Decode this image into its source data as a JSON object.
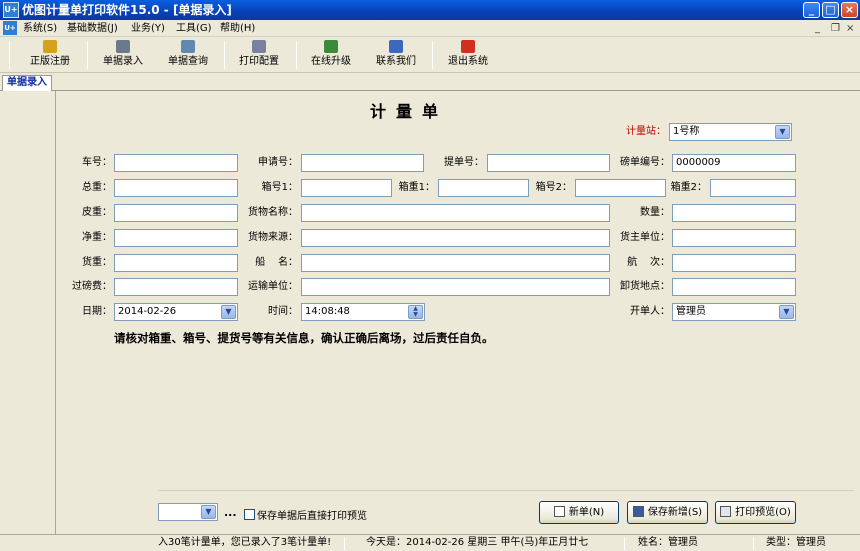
{
  "window": {
    "app_icon": "U+",
    "title": "优图计量单打印软件15.0 - [单据录入]"
  },
  "menu": [
    "系统(S)",
    "基础数据(J)",
    "业务(Y)",
    "工具(G)",
    "帮助(H)"
  ],
  "toolbar": [
    {
      "label": "正版注册",
      "icon": "lock-icon",
      "color": "#d8a020"
    },
    {
      "label": "单据录入",
      "icon": "edit-doc-icon",
      "color": "#6a7a8a"
    },
    {
      "label": "单据查询",
      "icon": "search-doc-icon",
      "color": "#6088b0"
    },
    {
      "label": "打印配置",
      "icon": "printer-config-icon",
      "color": "#7a80a0"
    },
    {
      "label": "在线升级",
      "icon": "upgrade-icon",
      "color": "#3a8a3a"
    },
    {
      "label": "联系我们",
      "icon": "home-icon",
      "color": "#3a6ab8"
    },
    {
      "label": "退出系统",
      "icon": "exit-icon",
      "color": "#d03020"
    }
  ],
  "tab": {
    "label": "单据录入"
  },
  "form": {
    "title": "计量单",
    "station_label": "计量站：",
    "station_value": "1号称",
    "fields": {
      "car_no": {
        "label": "车号：",
        "value": ""
      },
      "apply_no": {
        "label": "申请号：",
        "value": ""
      },
      "bill_no": {
        "label": "提单号：",
        "value": ""
      },
      "weigh_no": {
        "label": "磅单编号：",
        "value": "0000009"
      },
      "gross": {
        "label": "总重：",
        "value": ""
      },
      "box_no1": {
        "label": "箱号1：",
        "value": ""
      },
      "box_wt1": {
        "label": "箱重1：",
        "value": ""
      },
      "box_no2": {
        "label": "箱号2：",
        "value": ""
      },
      "box_wt2": {
        "label": "箱重2：",
        "value": ""
      },
      "tare": {
        "label": "皮重：",
        "value": ""
      },
      "goods_name": {
        "label": "货物名称：",
        "value": ""
      },
      "qty": {
        "label": "数量：",
        "value": ""
      },
      "net": {
        "label": "净重：",
        "value": ""
      },
      "goods_src": {
        "label": "货物来源：",
        "value": ""
      },
      "owner": {
        "label": "货主单位：",
        "value": ""
      },
      "cargo_wt": {
        "label": "货重：",
        "value": ""
      },
      "ship": {
        "label": "船    名：",
        "value": ""
      },
      "voyage": {
        "label": "航    次：",
        "value": ""
      },
      "fee": {
        "label": "过磅费：",
        "value": ""
      },
      "carrier": {
        "label": "运输单位：",
        "value": ""
      },
      "unload": {
        "label": "卸货地点：",
        "value": ""
      },
      "date": {
        "label": "日期：",
        "value": "2014-02-26"
      },
      "time": {
        "label": "时间：",
        "value": "14:08:48"
      },
      "issuer": {
        "label": "开单人：",
        "value": "管理员"
      }
    },
    "notice": "请核对箱重、箱号、提货号等有关信息，确认正确后离场，过后责任自负。"
  },
  "bottom": {
    "dots": "...",
    "preview_checkbox": "保存单据后直接打印预览",
    "new_btn": "新单(N)",
    "save_new_btn": "保存新增(S)",
    "print_preview_btn": "打印预览(O)"
  },
  "status": {
    "msg": "入30笔计量单，您已录入了3笔计量单!",
    "today": "今天是：2014-02-26 星期三 甲午(马)年正月廿七",
    "user": "姓名：管理员",
    "type": "类型：管理员"
  }
}
